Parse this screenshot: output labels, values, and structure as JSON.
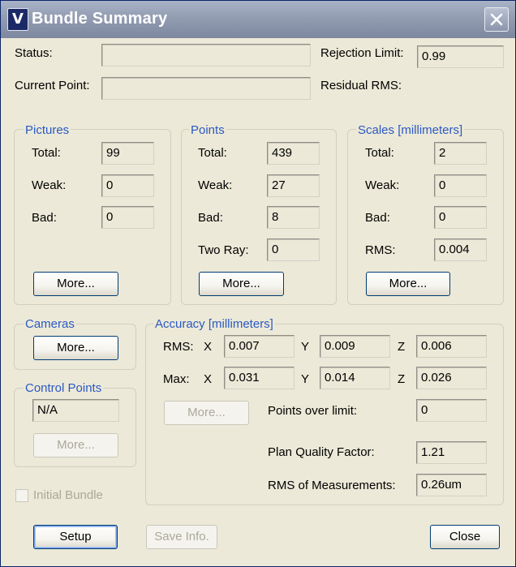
{
  "window": {
    "title": "Bundle Summary",
    "app_icon": "V",
    "close_icon": "close-icon"
  },
  "top": {
    "status_label": "Status:",
    "status_value": "",
    "current_point_label": "Current Point:",
    "current_point_value": "",
    "rejection_limit_label": "Rejection Limit:",
    "rejection_limit_value": "0.99",
    "residual_rms_label": "Residual RMS:"
  },
  "pictures": {
    "legend": "Pictures",
    "total_label": "Total:",
    "total_value": "99",
    "weak_label": "Weak:",
    "weak_value": "0",
    "bad_label": "Bad:",
    "bad_value": "0",
    "more_label": "More..."
  },
  "points": {
    "legend": "Points",
    "total_label": "Total:",
    "total_value": "439",
    "weak_label": "Weak:",
    "weak_value": "27",
    "bad_label": "Bad:",
    "bad_value": "8",
    "tworay_label": "Two Ray:",
    "tworay_value": "0",
    "more_label": "More..."
  },
  "scales": {
    "legend": "Scales [millimeters]",
    "total_label": "Total:",
    "total_value": "2",
    "weak_label": "Weak:",
    "weak_value": "0",
    "bad_label": "Bad:",
    "bad_value": "0",
    "rms_label": "RMS:",
    "rms_value": "0.004",
    "more_label": "More..."
  },
  "cameras": {
    "legend": "Cameras",
    "more_label": "More..."
  },
  "control_points": {
    "legend": "Control Points",
    "value": "N/A",
    "more_label": "More..."
  },
  "accuracy": {
    "legend": "Accuracy [millimeters]",
    "rms_label": "RMS:",
    "max_label": "Max:",
    "x_label": "X",
    "y_label": "Y",
    "z_label": "Z",
    "rms_x": "0.007",
    "rms_y": "0.009",
    "rms_z": "0.006",
    "max_x": "0.031",
    "max_y": "0.014",
    "max_z": "0.026",
    "more_label": "More...",
    "points_over_limit_label": "Points over limit:",
    "points_over_limit_value": "0",
    "plan_quality_label": "Plan Quality Factor:",
    "plan_quality_value": "1.21",
    "rms_meas_label": "RMS of Measurements:",
    "rms_meas_value": "0.26um"
  },
  "initial_bundle": {
    "label": "Initial Bundle",
    "checked": false
  },
  "footer": {
    "setup_label": "Setup",
    "save_info_label": "Save Info.",
    "close_label": "Close"
  }
}
